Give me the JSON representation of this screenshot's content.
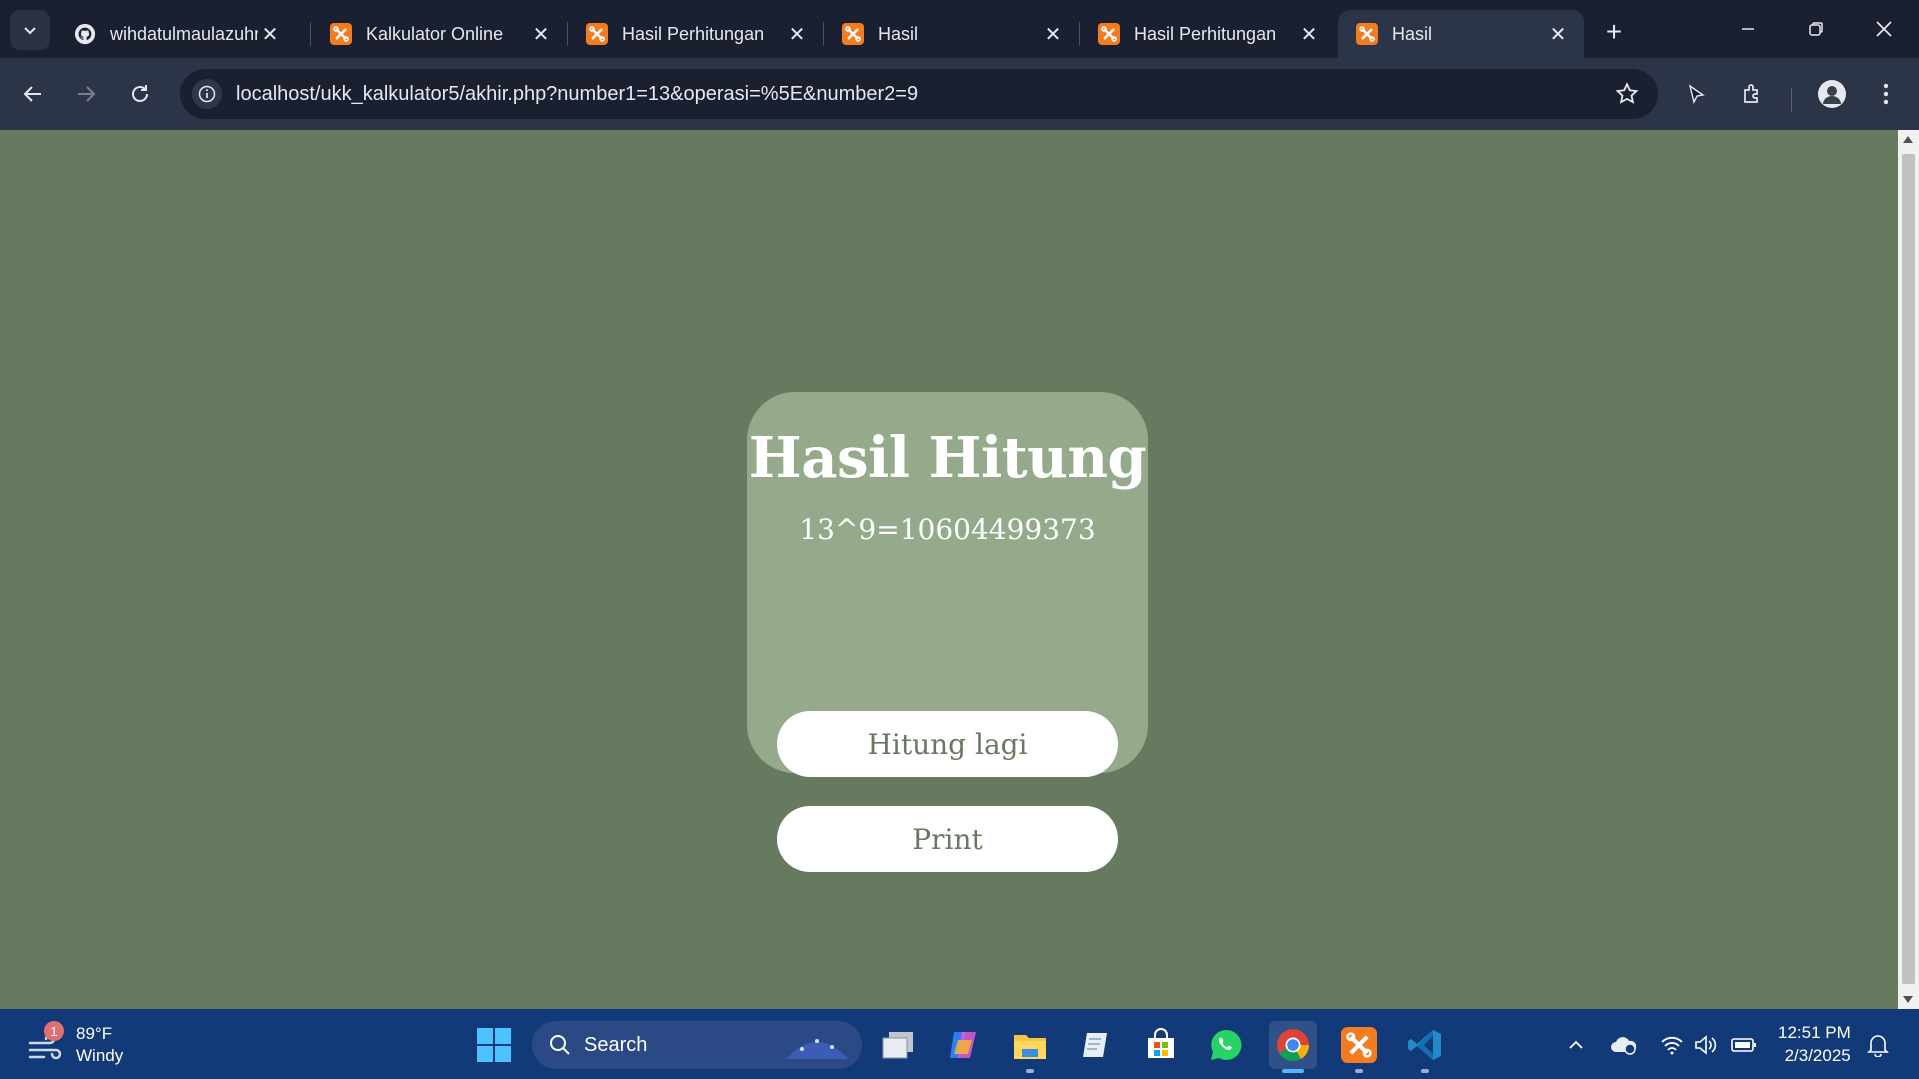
{
  "browser": {
    "tabs": [
      {
        "title": "wihdatulmaulazuhr",
        "favicon": "github-icon",
        "active": false
      },
      {
        "title": "Kalkulator Online",
        "favicon": "xampp-icon",
        "active": false
      },
      {
        "title": "Hasil Perhitungan",
        "favicon": "xampp-icon",
        "active": false
      },
      {
        "title": "Hasil",
        "favicon": "xampp-icon",
        "active": false
      },
      {
        "title": "Hasil Perhitungan",
        "favicon": "xampp-icon",
        "active": false
      },
      {
        "title": "Hasil",
        "favicon": "xampp-icon",
        "active": true
      }
    ],
    "address_bar": {
      "url": "localhost/ukk_kalkulator5/akhir.php?number1=13&operasi=%5E&number2=9"
    }
  },
  "page": {
    "card": {
      "title": "Hasil Hitung",
      "result": "13^9=10604499373",
      "hitung_lagi_label": "Hitung lagi",
      "print_label": "Print"
    },
    "colors": {
      "background": "#667a60",
      "card": "#95aa8b",
      "button_bg": "#ffffff",
      "button_text": "#667a60"
    }
  },
  "taskbar": {
    "weather": {
      "temperature": "89°F",
      "condition": "Windy",
      "badge": "1"
    },
    "search_label": "Search",
    "clock": {
      "time": "12:51 PM",
      "date": "2/3/2025"
    },
    "apps": [
      "windows-start-icon",
      "task-view-icon",
      "copilot-icon",
      "file-explorer-icon",
      "notepad-icon",
      "microsoft-store-icon",
      "whatsapp-icon",
      "chrome-icon",
      "xampp-icon",
      "vscode-icon"
    ]
  }
}
